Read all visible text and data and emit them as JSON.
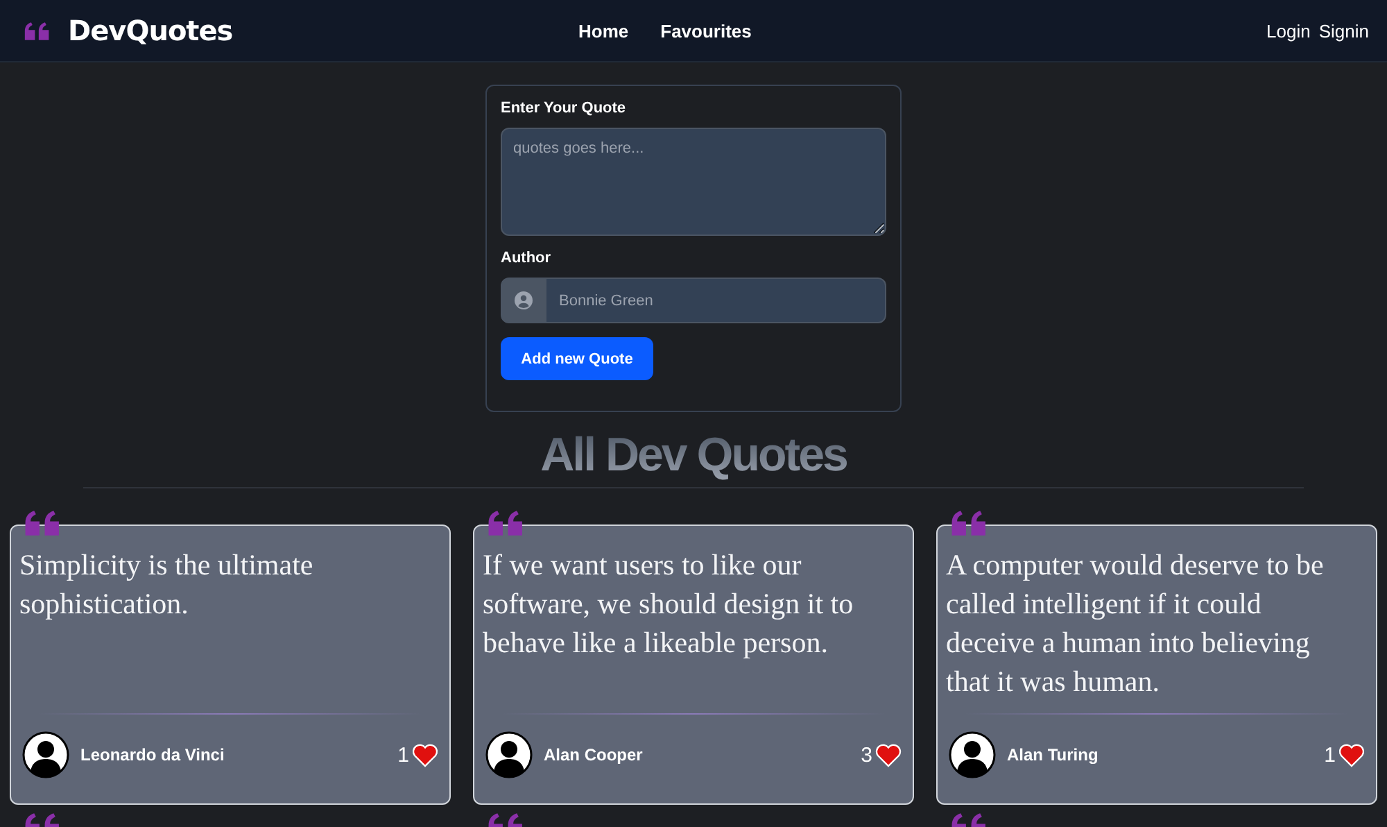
{
  "navbar": {
    "brand": "DevQuotes",
    "links": [
      {
        "label": "Home"
      },
      {
        "label": "Favourites"
      }
    ],
    "auth": [
      {
        "label": "Login"
      },
      {
        "label": "Signin"
      }
    ]
  },
  "form": {
    "quote_label": "Enter Your Quote",
    "quote_placeholder": "quotes goes here...",
    "author_label": "Author",
    "author_placeholder": "Bonnie Green",
    "submit": "Add new Quote"
  },
  "section_title": "All Dev Quotes",
  "quotes": [
    {
      "text": "Simplicity is the ultimate sophistication.",
      "author": "Leonardo da Vinci",
      "likes": "1"
    },
    {
      "text": "If we want users to like our software, we should design it to behave like a likeable person.",
      "author": "Alan Cooper",
      "likes": "3"
    },
    {
      "text": "A computer would deserve to be called intelligent if it could deceive a human into believing that it was human.",
      "author": "Alan Turing",
      "likes": "1"
    }
  ]
}
